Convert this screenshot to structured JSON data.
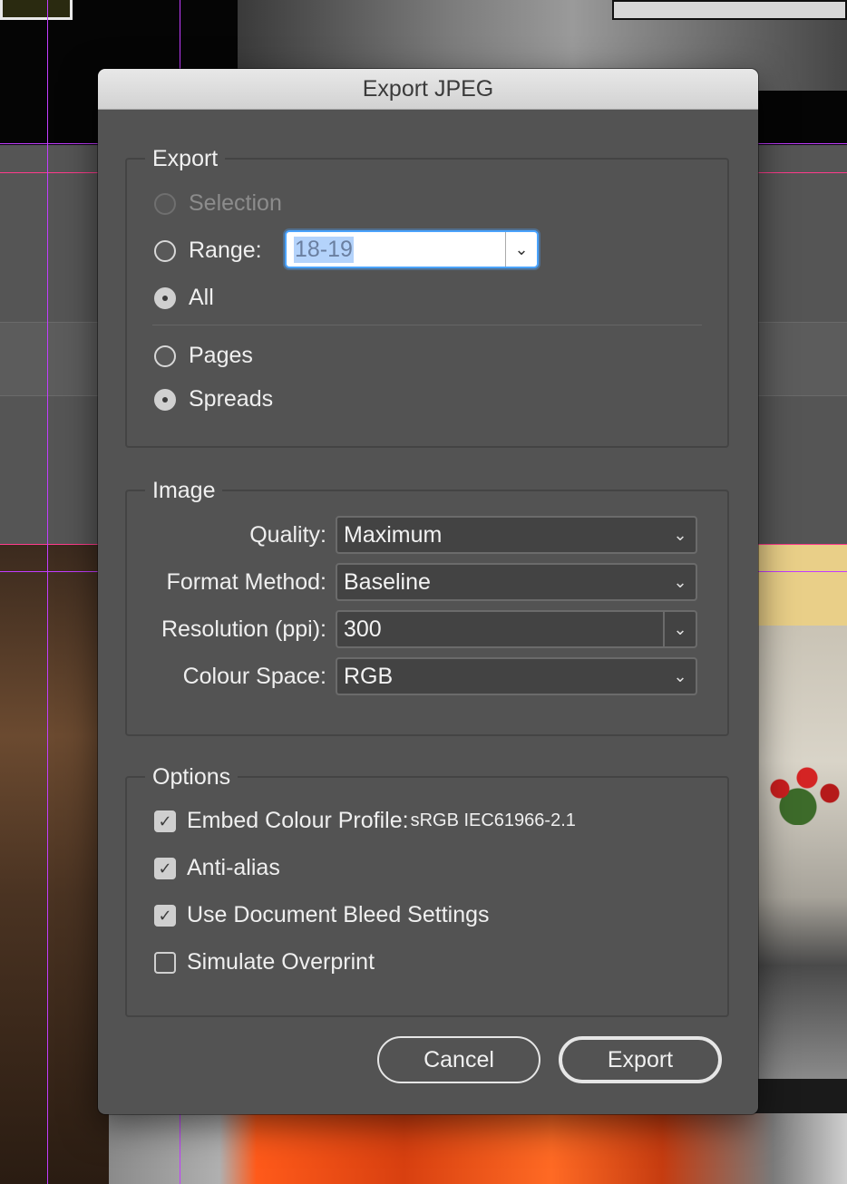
{
  "dialog": {
    "title": "Export JPEG",
    "export_group": {
      "label": "Export",
      "selection_label": "Selection",
      "range_label": "Range:",
      "range_value": "18-19",
      "all_label": "All",
      "pages_label": "Pages",
      "spreads_label": "Spreads",
      "selected_scope": "All",
      "selected_layout": "Spreads"
    },
    "image_group": {
      "label": "Image",
      "quality_label": "Quality:",
      "quality_value": "Maximum",
      "format_label": "Format Method:",
      "format_value": "Baseline",
      "resolution_label": "Resolution (ppi):",
      "resolution_value": "300",
      "colour_label": "Colour Space:",
      "colour_value": "RGB"
    },
    "options_group": {
      "label": "Options",
      "embed_label": "Embed Colour Profile:",
      "embed_profile": "sRGB IEC61966-2.1",
      "embed_checked": true,
      "antialias_label": "Anti-alias",
      "antialias_checked": true,
      "bleed_label": "Use Document Bleed Settings",
      "bleed_checked": true,
      "overprint_label": "Simulate Overprint",
      "overprint_checked": false
    },
    "buttons": {
      "cancel": "Cancel",
      "export": "Export"
    }
  },
  "icons": {
    "check": "✓",
    "chevron": "⌄"
  }
}
